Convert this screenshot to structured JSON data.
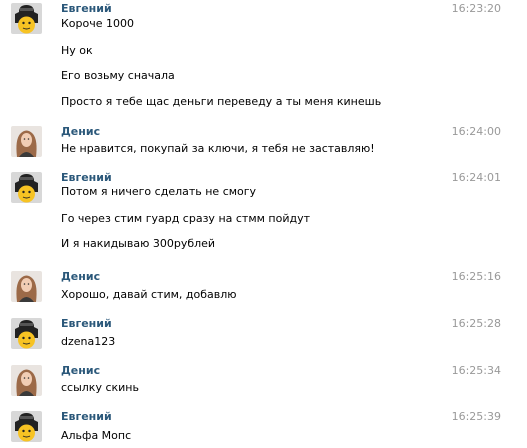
{
  "messages": [
    {
      "author": "Евгений",
      "avatar_icon": "bag-emoji-avatar-icon",
      "time": "16:23:20",
      "lines": [
        "Короче 1000",
        "Ну ок",
        "Его возьму сначала",
        "Просто я тебе щас деньги переведу а ты меня кинешь"
      ]
    },
    {
      "author": "Денис",
      "avatar_icon": "girl-photo-avatar-icon",
      "time": "16:24:00",
      "lines": [
        "Не нравится, покупай за ключи, я тебя не заставляю!"
      ]
    },
    {
      "author": "Евгений",
      "avatar_icon": "bag-emoji-avatar-icon",
      "time": "16:24:01",
      "lines": [
        "Потом я ничего сделать не смогу",
        "Го через стим гуард сразу на стмм пойдут",
        "И я накидываю 300рублей"
      ]
    },
    {
      "author": "Денис",
      "avatar_icon": "girl-photo-avatar-icon",
      "time": "16:25:16",
      "lines": [
        "Хорошо, давай стим, добавлю"
      ]
    },
    {
      "author": "Евгений",
      "avatar_icon": "bag-emoji-avatar-icon",
      "time": "16:25:28",
      "lines": [
        "dzena123"
      ]
    },
    {
      "author": "Денис",
      "avatar_icon": "girl-photo-avatar-icon",
      "time": "16:25:34",
      "lines": [
        "ссылку скинь"
      ]
    },
    {
      "author": "Евгений",
      "avatar_icon": "bag-emoji-avatar-icon",
      "time": "16:25:39",
      "lines": [
        "Альфа Мопс"
      ]
    }
  ],
  "colors": {
    "author": "#2b587a",
    "time": "#999999",
    "text": "#000000"
  }
}
